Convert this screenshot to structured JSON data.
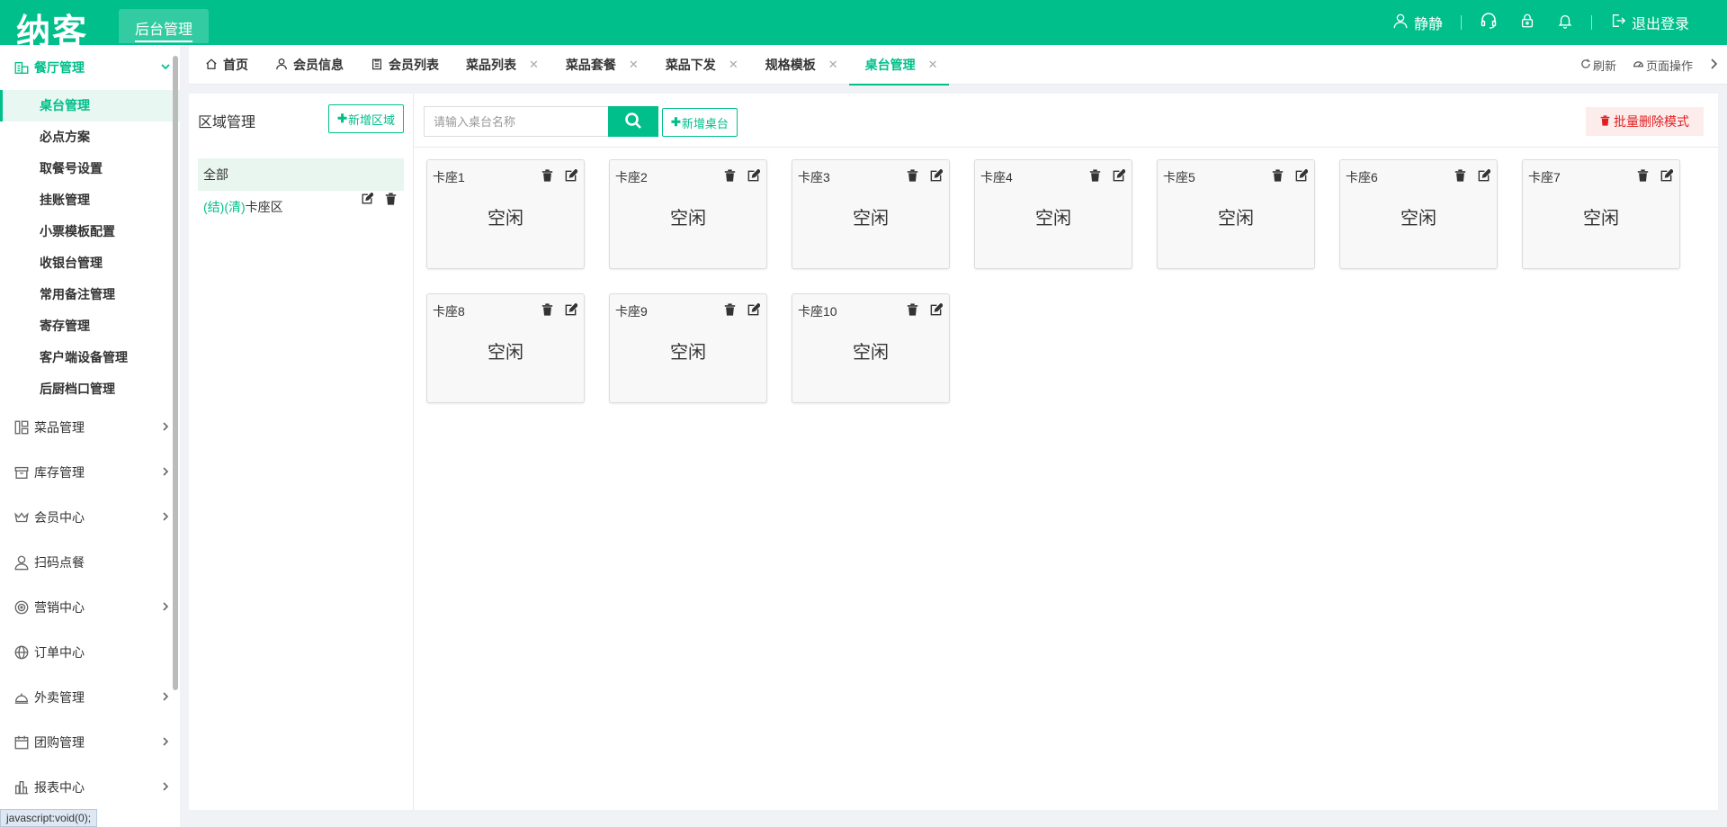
{
  "header": {
    "logo": "纳客",
    "module": "后台管理",
    "user": "静静",
    "logout": "退出登录"
  },
  "sidebar": {
    "groups": [
      {
        "label": "餐厅管理",
        "open": true,
        "items": [
          {
            "label": "桌台管理",
            "active": true
          },
          {
            "label": "必点方案"
          },
          {
            "label": "取餐号设置"
          },
          {
            "label": "挂账管理"
          },
          {
            "label": "小票模板配置"
          },
          {
            "label": "收银台管理"
          },
          {
            "label": "常用备注管理"
          },
          {
            "label": "寄存管理"
          },
          {
            "label": "客户端设备管理"
          },
          {
            "label": "后厨档口管理"
          }
        ]
      },
      {
        "label": "菜品管理"
      },
      {
        "label": "库存管理"
      },
      {
        "label": "会员中心"
      },
      {
        "label": "扫码点餐"
      },
      {
        "label": "营销中心"
      },
      {
        "label": "订单中心"
      },
      {
        "label": "外卖管理"
      },
      {
        "label": "团购管理"
      },
      {
        "label": "报表中心"
      }
    ]
  },
  "status_tip": "javascript:void(0);",
  "tabs": [
    {
      "label": "首页"
    },
    {
      "label": "会员信息"
    },
    {
      "label": "会员列表"
    },
    {
      "label": "菜品列表",
      "closable": true
    },
    {
      "label": "菜品套餐",
      "closable": true
    },
    {
      "label": "菜品下发",
      "closable": true
    },
    {
      "label": "规格模板",
      "closable": true
    },
    {
      "label": "桌台管理",
      "closable": true,
      "active": true
    }
  ],
  "tab_actions": {
    "refresh": "刷新",
    "page_ops": "页面操作"
  },
  "area": {
    "title": "区域管理",
    "add_label": "新增区域",
    "all_label": "全部",
    "rows": [
      {
        "tag": "(结)(清)",
        "name": "卡座区"
      }
    ]
  },
  "toolbar": {
    "search_placeholder": "请输入桌台名称",
    "add_table_label": "新增桌台",
    "batch_delete_label": "批量删除模式"
  },
  "tables": [
    {
      "name": "卡座1",
      "status": "空闲"
    },
    {
      "name": "卡座2",
      "status": "空闲"
    },
    {
      "name": "卡座3",
      "status": "空闲"
    },
    {
      "name": "卡座4",
      "status": "空闲"
    },
    {
      "name": "卡座5",
      "status": "空闲"
    },
    {
      "name": "卡座6",
      "status": "空闲"
    },
    {
      "name": "卡座7",
      "status": "空闲"
    },
    {
      "name": "卡座8",
      "status": "空闲"
    },
    {
      "name": "卡座9",
      "status": "空闲"
    },
    {
      "name": "卡座10",
      "status": "空闲"
    }
  ],
  "colors": {
    "primary": "#00bf8a",
    "danger": "#e02020",
    "danger_bg": "#fdecec"
  }
}
